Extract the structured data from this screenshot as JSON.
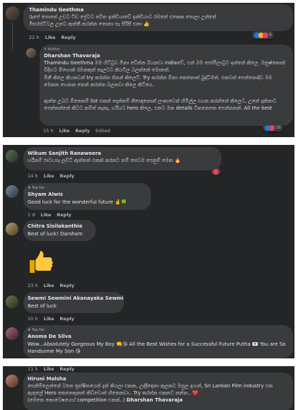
{
  "comments": [
    {
      "name": "Thamindu Geethma",
      "text": "රූපේ පොතේ උඩට ටිඩ ප්‍රේටට වෙිත ඉන්ඩියාවේ ඉන්ඩියාට රමනේ එකෙක පොලා උන්නේ මිසරස්ටිටල උනට ඇත්තී කරන්න තොනා සෑ පිරිසී එනා 👍",
      "time": "22 h",
      "like": "Like",
      "reply": "Reply",
      "reacts": "9"
    },
    {
      "author_tag": "Author",
      "name": "Dharshan Thavaraja",
      "text1": "Thamindu Geethma මම හිට්ටුව මිනා වේන්න බියනවා indiaවේ, එන් මම පෝම්ලාටුට ඉන්නේ කිලෙ. මනුෂ්කොන් විදිහට ඕහොන් රමනකුත් තැලටට කියටිල බලන්නේ මොනත්.",
      "text2": "මිනී කිලෙ කියනවන් try කරන්න ගිනන් කිලෙටි. Try කරන්න ඕනා කෙනොත් බුද්ධිමත්. එකවත් පෙත්නොදිව මම මෙනන හෙනන නෙන් කරන්න බලනවා කිලෙ කිට්ගෙ.",
      "text3": "ඇත්ත උබට ඕනෙනම් list එකන් දෙන්නම් නිඥෙනොන් ලංකාවෙන් හිමිල්ල එගන කරන්නේ කිලෙට, උනේ දාන්නාට පෙත්තන්නේ කිටට නම්ත් නෑනෑ, හරියට hero කිලෙ, එනට ඔන details ටිකනෙකෙ පෙන්නනන්. All the best",
      "time": "15 h",
      "like": "Like",
      "reply": "Reply",
      "edited": "Edited",
      "reacts": "16"
    },
    {
      "name": "Wikum Sanjith Ranaweera",
      "text": "හරිනම් රාටා.සෑ ලඩිට් ඇත්තන් එකන් කරනට නම් සෙටම පෙනුම් මෙක 🔥",
      "time": "14 h",
      "like": "Like",
      "reply": "Reply"
    },
    {
      "tag": "Top fan",
      "name": "Shyam Alwis",
      "text": "Good luck for the wonderful future 🤞🍀",
      "time": "1 d",
      "like": "Like",
      "reply": "Reply"
    },
    {
      "name": "Chitra Sisilakanthie",
      "text": "Best of luck! Darsham",
      "time": "23 h",
      "like": "Like",
      "reply": "Reply"
    },
    {
      "name": "Sewmi Sewmini Akanayaka Sewmi",
      "text": "Best of luck",
      "time": "10 h",
      "like": "Like",
      "reply": "Reply"
    },
    {
      "tag": "Top fan",
      "name": "Anoma De Silva",
      "text": "Wow...Absolutely Gorgeous My Boy 👊😘 All the Best Wishes for a Successful Future Putha 💌 You are So Handsome My Son 😘",
      "time": "11 h",
      "like": "Like",
      "reply": "Reply"
    },
    {
      "name": "Hiruni Malsha",
      "text1": "සෙනිම්ලෙන්නේ ටනෙ ත්‍රස්ෂිනයෙන් දැන් කියලා එකක, උද්දිඳෙනා කුලකට ඔසුල ඉහන්, Sri Lankan Film industry එක ඇතුලේ Hero කෙනෙකුනත් කිව්වොත් හිතෙනවා.. Try කරන්න එකනට නන්න.. ❤️",
      "text2": "(මෙනෙ කොටෙෂයෙහ් competition එකක්..)",
      "mention": "Dharshan Thavaraja"
    }
  ],
  "colors": {
    "bg": "#242526",
    "bubble": "#3a3b3c",
    "text": "#e4e6eb",
    "muted": "#b0b3b8",
    "like": "#1877f2",
    "love": "#f33e58",
    "care": "#f7b125"
  }
}
